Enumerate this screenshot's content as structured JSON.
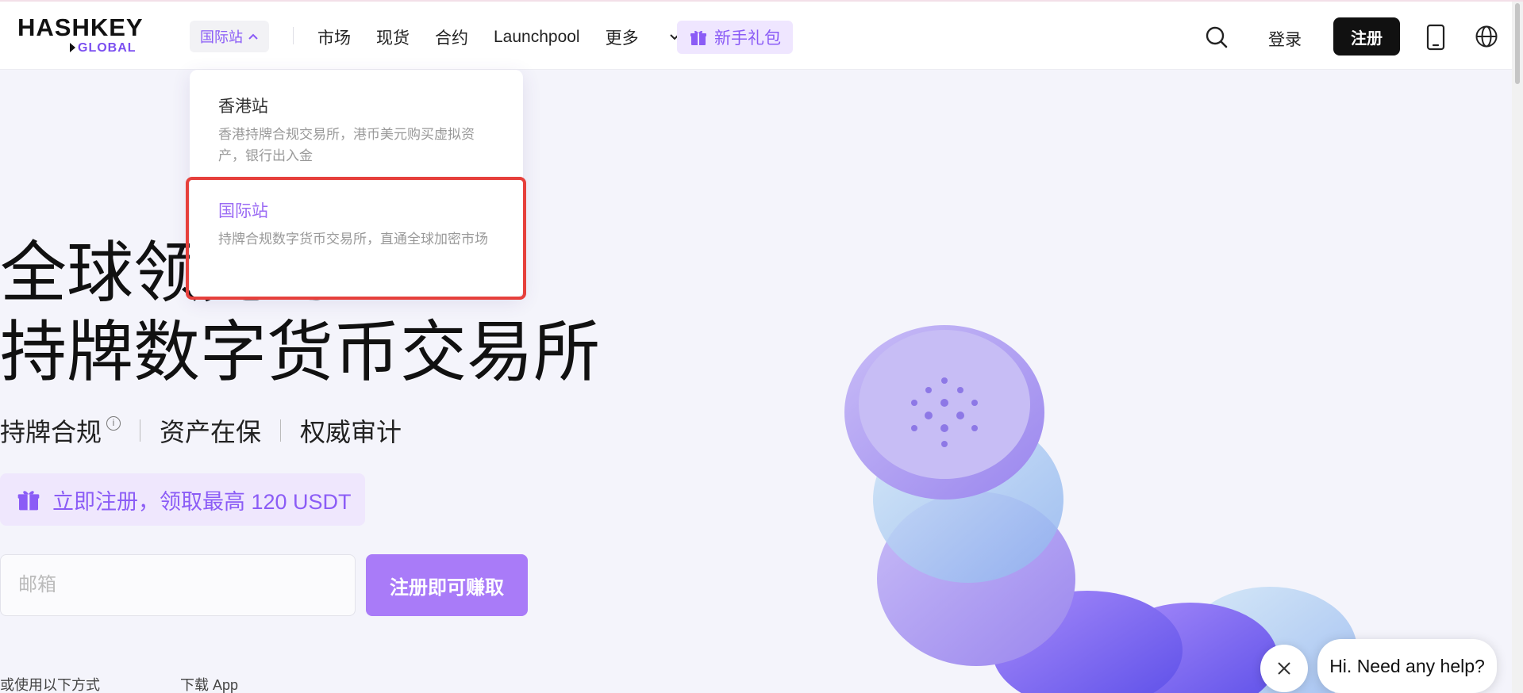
{
  "logo": {
    "line1": "HASHKEY",
    "line2": "GLOBAL"
  },
  "site_switch": {
    "label": "国际站"
  },
  "nav": {
    "items": [
      "市场",
      "现货",
      "合约",
      "Launchpool",
      "更多"
    ]
  },
  "gift_pill": {
    "label": "新手礼包"
  },
  "header": {
    "login": "登录",
    "signup": "注册"
  },
  "dropdown": {
    "items": [
      {
        "title": "香港站",
        "desc": "香港持牌合规交易所，港币美元购买虚拟资产，银行出入金"
      },
      {
        "title": "国际站",
        "desc": "持牌合规数字货币交易所，直通全球加密市场"
      }
    ]
  },
  "hero": {
    "line1": "全球领先的",
    "line2": "持牌数字货币交易所",
    "features": [
      "持牌合规",
      "资产在保",
      "权威审计"
    ],
    "info_glyph": "i"
  },
  "promo": {
    "text": "立即注册，领取最高 120 USDT"
  },
  "form": {
    "email_placeholder": "邮箱",
    "cta": "注册即可赚取"
  },
  "bottom": {
    "alt_login": "或使用以下方式",
    "download": "下载 App"
  },
  "help": {
    "text": "Hi. Need any help?"
  },
  "colors": {
    "accent": "#8b5cf6",
    "highlight_border": "#e6403c",
    "dark_button": "#111111"
  }
}
